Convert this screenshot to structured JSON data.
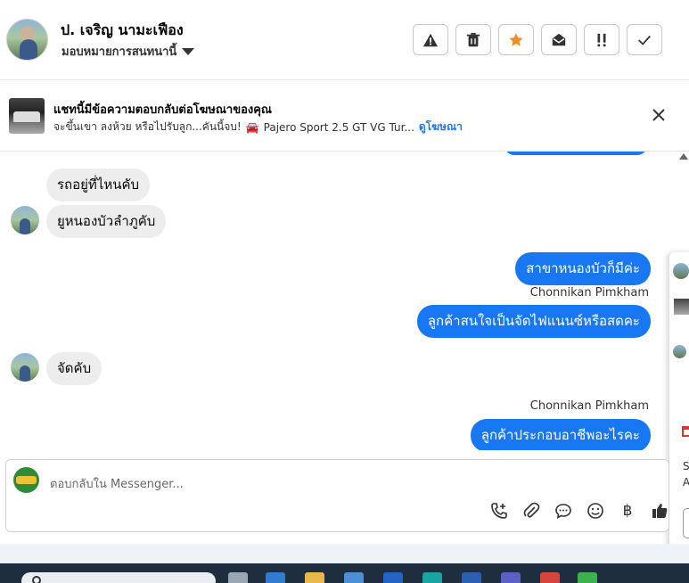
{
  "header": {
    "contact_name": "ป. เจริญ นามะเฟือง",
    "assign_label": "มอบหมายการสนทนานี้",
    "toolbar": [
      {
        "icon": "warning-icon",
        "label": "!"
      },
      {
        "icon": "trash-icon",
        "label": ""
      },
      {
        "icon": "star-icon",
        "label": "★"
      },
      {
        "icon": "mark-unread-icon",
        "label": ""
      },
      {
        "icon": "priority-icon",
        "label": "!!"
      },
      {
        "icon": "done-check-icon",
        "label": "✓"
      }
    ]
  },
  "ad_banner": {
    "title": "แชทนี้มีข้อความตอบกลับต่อโฆษณาของคุณ",
    "text": "จะขึ้นเขา ลงห้วย หรือไปรับลูก...คันนี้จบ!",
    "car_name": "Pajero Sport 2.5 GT VG Tur...",
    "link_label": "ดูโฆษณา"
  },
  "messages": {
    "m1": "รถอยู่ที่ไหนคับ",
    "m2": "ยูหนองบัวลำภูคับ",
    "m3": "สาขาหนองบัวก็มีค่ะ",
    "sender1": "Chonnikan Pimkham",
    "m4": "ลูกค้าสนใจเป็นจัดไฟแนนซ์หรือสดคะ",
    "m5": "จัดคับ",
    "sender2": "Chonnikan Pimkham",
    "m6": "ลูกค้าประกอบอาชีพอะไรคะ"
  },
  "overlay": {
    "letter_s": "S",
    "letter_a": "A"
  },
  "composer": {
    "placeholder": "ตอบกลับใน Messenger...",
    "icons": [
      "add-call-icon",
      "attachment-icon",
      "saved-reply-icon",
      "emoji-icon",
      "baht-icon",
      "thumbs-up-icon"
    ],
    "baht_symbol": "฿"
  },
  "colors": {
    "accent": "#1877f2",
    "incoming_bubble": "#ededed",
    "star": "#f28b22"
  }
}
